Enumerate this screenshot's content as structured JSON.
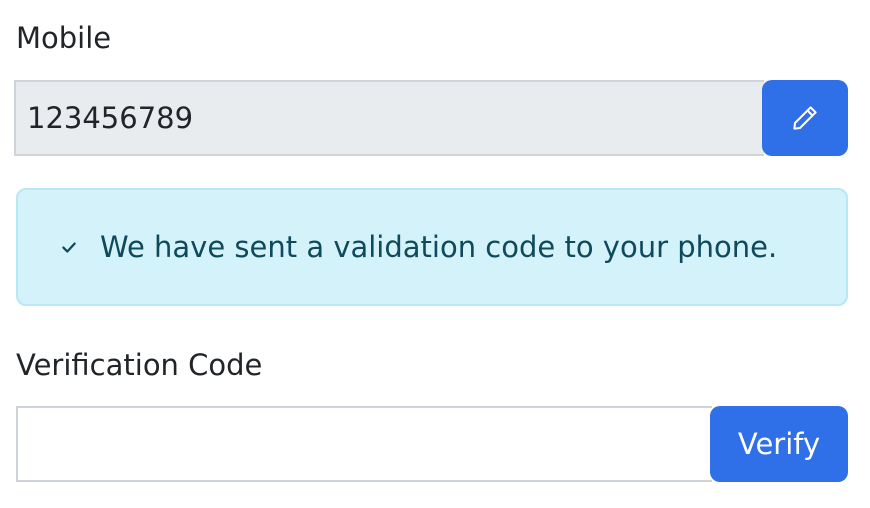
{
  "mobile": {
    "label": "Mobile",
    "value": "123456789",
    "edit_icon": "pencil-icon"
  },
  "alert": {
    "icon": "check-icon",
    "message": "We have sent a validation code to your phone."
  },
  "verification": {
    "label": "Verification Code",
    "value": "",
    "button_label": "Verify"
  },
  "colors": {
    "primary": "#2f6fe8",
    "alert_bg": "#d4f2f9",
    "alert_text": "#0e4a5c",
    "readonly_bg": "#e9ecef"
  }
}
